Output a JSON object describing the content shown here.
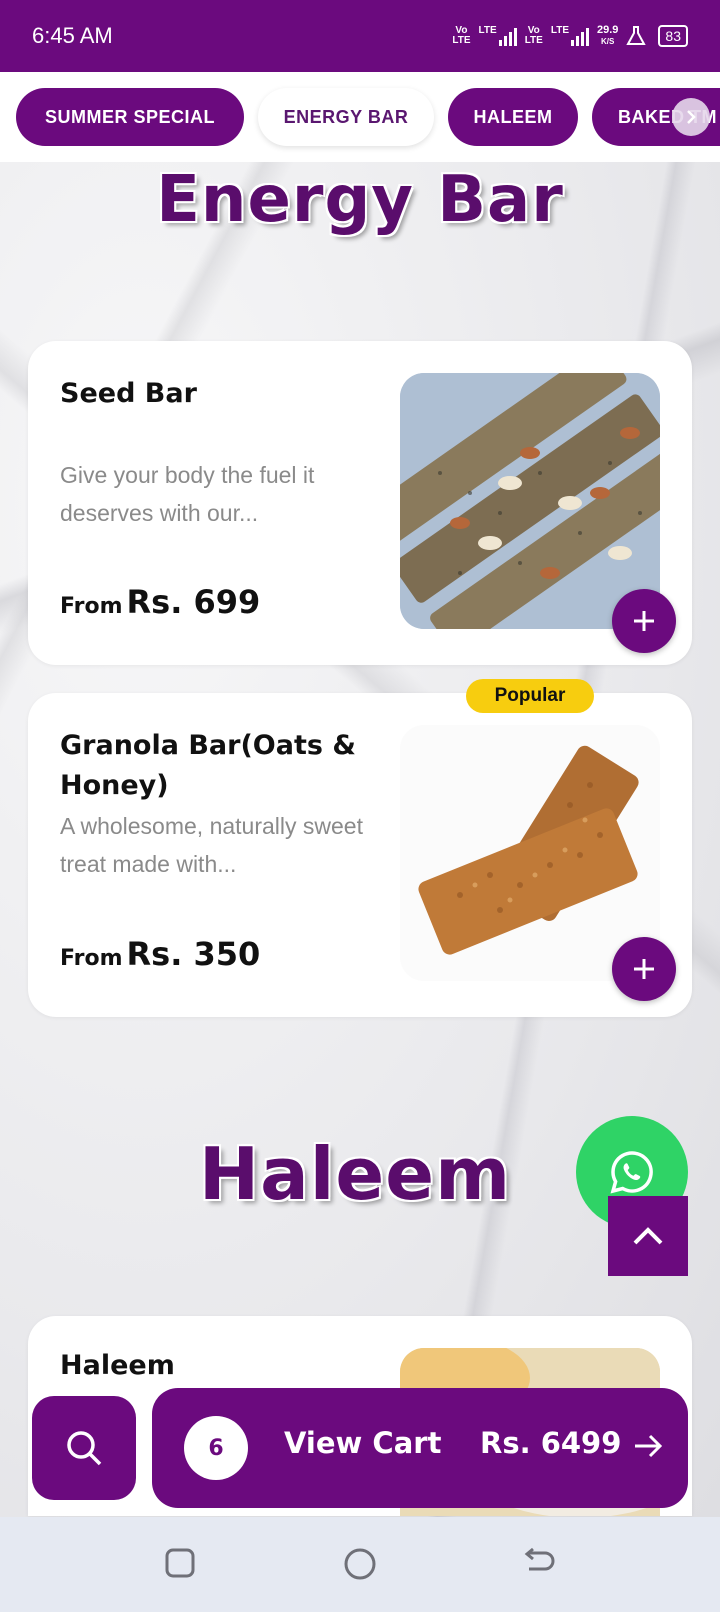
{
  "status_bar": {
    "time": "6:45 AM",
    "net1": "Vo\nLTE",
    "lte1": "LTE",
    "net2": "Vo\nLTE",
    "lte2": "LTE",
    "speed_value": "29.9",
    "speed_unit": "K/S",
    "battery": "83"
  },
  "tabs": [
    {
      "label": "SUMMER SPECIAL",
      "active": false
    },
    {
      "label": "ENERGY BAR",
      "active": true
    },
    {
      "label": "HALEEM",
      "active": false
    },
    {
      "label": "BAKED TM",
      "active": false
    }
  ],
  "sections": {
    "energy_bar_heading": "Energy Bar",
    "haleem_heading": "Haleem"
  },
  "products": [
    {
      "name": "Seed Bar",
      "description": "Give your body the fuel it deserves with our...",
      "price_prefix": "From",
      "price": "Rs. 699",
      "image_icon": "seed-bar-photo"
    },
    {
      "name": "Granola Bar(Oats & Honey)",
      "description": "A wholesome, naturally sweet treat made with...",
      "price_prefix": "From",
      "price": "Rs. 350",
      "badge": "Popular",
      "image_icon": "granola-bar-photo"
    },
    {
      "name": "Haleem",
      "image_icon": "haleem-photo"
    }
  ],
  "cart": {
    "count": "6",
    "label": "View Cart",
    "total": "Rs. 6499"
  },
  "colors": {
    "brand": "#6b0a7e",
    "badge": "#f7cd0f",
    "whatsapp": "#2fd366"
  }
}
